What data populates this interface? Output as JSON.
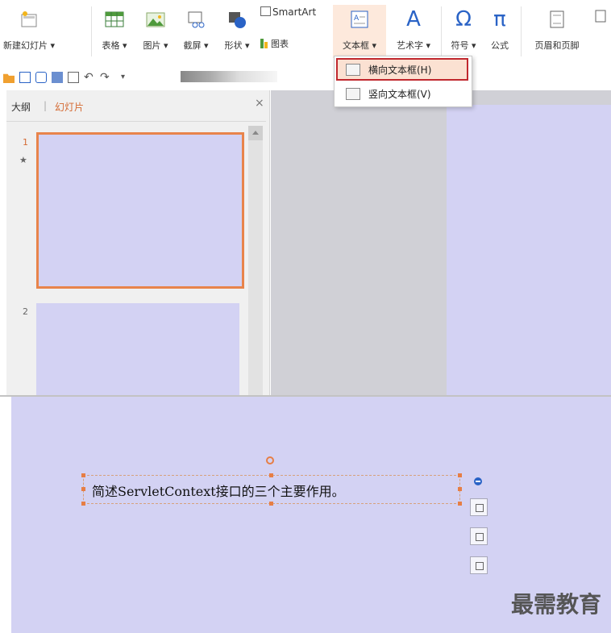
{
  "ribbon": {
    "new_slide": "新建幻灯片",
    "table": "表格",
    "picture": "图片",
    "screenshot": "截屏",
    "shape": "形状",
    "smartart": "SmartArt",
    "chart": "图表",
    "textbox": "文本框",
    "wordart": "艺术字",
    "symbol": "符号",
    "formula": "公式",
    "header_footer": "页眉和页脚"
  },
  "dropdown": {
    "horizontal": "横向文本框(H)",
    "vertical": "竖向文本框(V)"
  },
  "panel": {
    "tab_outline": "大纲",
    "tab_slides": "幻灯片",
    "close": "×",
    "slide1_num": "1",
    "slide2_num": "2",
    "anim_mark": "★"
  },
  "canvas": {
    "textbox_text": "简述ServletContext接口的三个主要作用。"
  },
  "watermark": "最需教育",
  "colors": {
    "accent": "#e8844b",
    "highlight_border": "#c0282e",
    "slide_bg": "#d3d2f3",
    "active_tab": "#d46a33"
  }
}
